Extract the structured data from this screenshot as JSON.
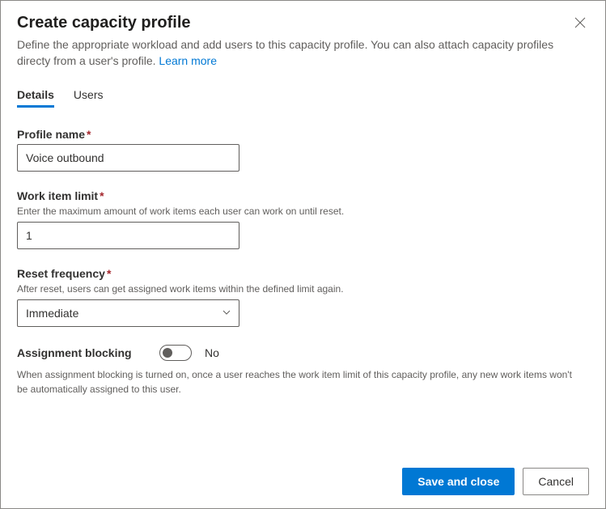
{
  "header": {
    "title": "Create capacity profile",
    "subtitle_a": "Define the appropriate workload and add users to this capacity profile. You can also attach capacity profiles directy from a user's profile. ",
    "learn_more": "Learn more"
  },
  "tabs": {
    "details": "Details",
    "users": "Users"
  },
  "fields": {
    "profile_name": {
      "label": "Profile name",
      "value": "Voice outbound"
    },
    "work_item_limit": {
      "label": "Work item limit",
      "help": "Enter the maximum amount of work items each user can work on until reset.",
      "value": "1"
    },
    "reset_frequency": {
      "label": "Reset frequency",
      "help": "After reset, users can get assigned work items within the defined limit again.",
      "value": "Immediate"
    },
    "assignment_blocking": {
      "label": "Assignment blocking",
      "value_text": "No",
      "help": "When assignment blocking is turned on, once a user reaches the work item limit of this capacity profile, any new work items won't be automatically assigned to this user."
    }
  },
  "footer": {
    "save": "Save and close",
    "cancel": "Cancel"
  }
}
